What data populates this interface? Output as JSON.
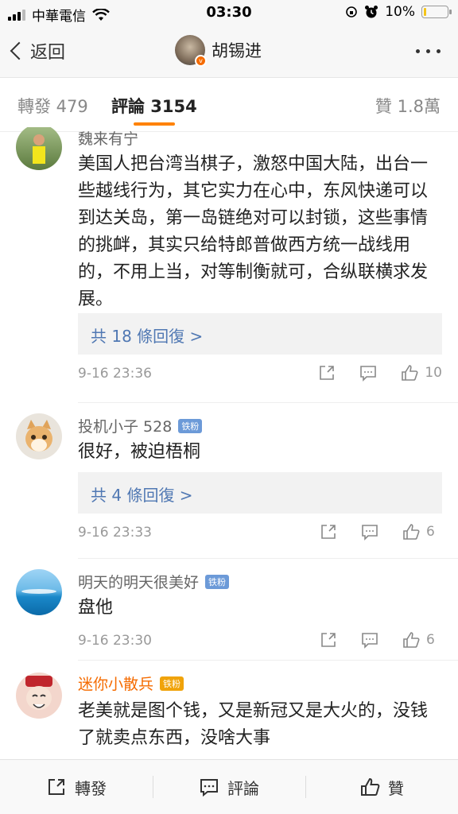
{
  "status_bar": {
    "carrier": "中華電信",
    "time": "03:30",
    "battery": "10%",
    "battery_level": 0.1
  },
  "nav": {
    "back_label": "返回",
    "title": "胡锡进",
    "verified_badge": "v"
  },
  "tabs": {
    "repost": "轉發 479",
    "comments": "評論 3154",
    "likes": "贊 1.8萬"
  },
  "comments": [
    {
      "name": "魏来有宁",
      "text": "美国人把台湾当棋子，激怒中国大陆，出台一些越线行为，其它实力在心中，东风快递可以到达关岛，第一岛链绝对可以封锁，这些事情的挑衅，其实只给特郎普做西方统一战线用的，不用上当，对等制衡就可，合纵联横求发展。",
      "replies": "共 18 條回復 >",
      "time": "9-16 23:36",
      "likes": "10"
    },
    {
      "name": "投机小子 528",
      "badge": "铁粉",
      "text": "很好，被迫梧桐",
      "replies": "共 4 條回復 >",
      "time": "9-16 23:33",
      "likes": "6"
    },
    {
      "name": "明天的明天很美好",
      "badge": "铁粉",
      "text": "盘他",
      "time": "9-16 23:30",
      "likes": "6"
    },
    {
      "name": "迷你小散兵",
      "badge": "铁粉",
      "text": "老美就是图个钱，又是新冠又是大火的，没钱了就卖点东西，没啥大事"
    }
  ],
  "bottom_bar": {
    "repost": "轉發",
    "comment": "評論",
    "like": "贊"
  },
  "colors": {
    "accent": "#ff8200",
    "link": "#5078b3",
    "vip_name": "#f56b00"
  }
}
